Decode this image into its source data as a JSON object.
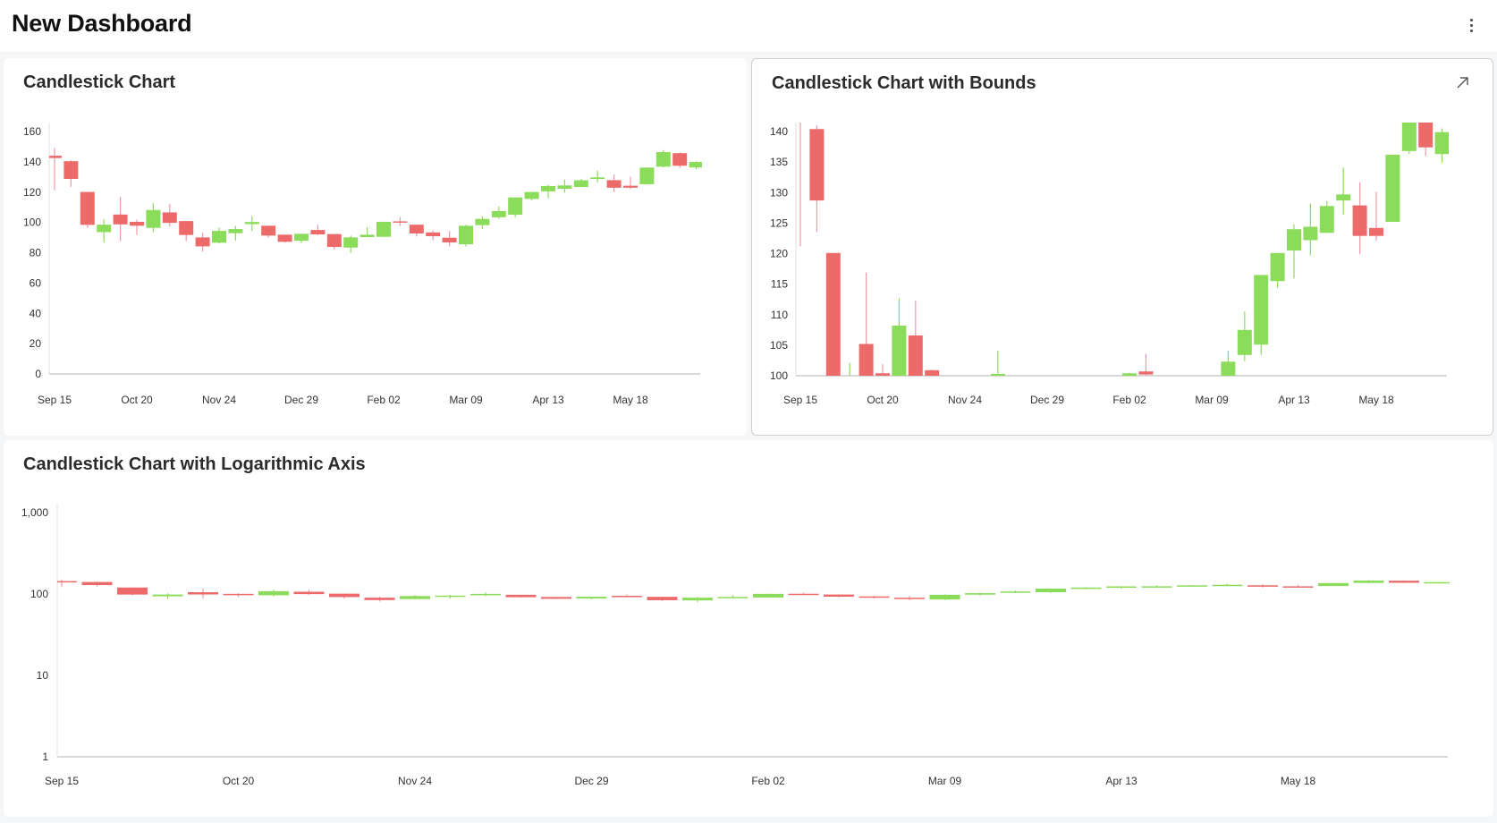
{
  "header": {
    "title": "New Dashboard",
    "more_icon": "more-vertical-icon"
  },
  "colors": {
    "up": "#8cdc5c",
    "down": "#ec6a6a",
    "down_wick": "#f29aa8",
    "axis": "#d9d9d9",
    "background": "#f5f6f8"
  },
  "cards": [
    {
      "title": "Candlestick Chart"
    },
    {
      "title": "Candlestick Chart with Bounds",
      "expand_icon": "expand-arrow-icon"
    },
    {
      "title": "Candlestick Chart with Logarithmic Axis"
    }
  ],
  "chart_data": [
    {
      "type": "candlestick",
      "title": "Candlestick Chart",
      "y_scale": "linear",
      "ylim": [
        0,
        160
      ],
      "yticks": [
        0,
        20,
        40,
        60,
        80,
        100,
        120,
        140,
        160
      ],
      "ytick_labels": [
        "0",
        "20",
        "40",
        "60",
        "80",
        "100",
        "120",
        "140",
        "160"
      ],
      "xtick_labels": [
        "Sep 15",
        "Oct 20",
        "Nov 24",
        "Dec 29",
        "Feb 02",
        "Mar 09",
        "Apr 13",
        "May 18"
      ],
      "xtick_index": [
        0,
        5,
        10,
        15,
        20,
        25,
        30,
        35
      ],
      "series_ref": "ohlc"
    },
    {
      "type": "candlestick",
      "title": "Candlestick Chart with Bounds",
      "y_scale": "linear",
      "ylim": [
        100,
        140
      ],
      "yticks": [
        100,
        105,
        110,
        115,
        120,
        125,
        130,
        135,
        140
      ],
      "ytick_labels": [
        "100",
        "105",
        "110",
        "115",
        "120",
        "125",
        "130",
        "135",
        "140"
      ],
      "xtick_labels": [
        "Sep 15",
        "Oct 20",
        "Nov 24",
        "Dec 29",
        "Feb 02",
        "Mar 09",
        "Apr 13",
        "May 18"
      ],
      "xtick_index": [
        0,
        5,
        10,
        15,
        20,
        25,
        30,
        35
      ],
      "series_ref": "ohlc"
    },
    {
      "type": "candlestick",
      "title": "Candlestick Chart with Logarithmic Axis",
      "y_scale": "log",
      "ylim": [
        1,
        1000
      ],
      "yticks": [
        1,
        10,
        100,
        1000
      ],
      "ytick_labels": [
        "1",
        "10",
        "100",
        "1,000"
      ],
      "xtick_labels": [
        "Sep 15",
        "Oct 20",
        "Nov 24",
        "Dec 29",
        "Feb 02",
        "Mar 09",
        "Apr 13",
        "May 18"
      ],
      "xtick_index": [
        0,
        5,
        10,
        15,
        20,
        25,
        30,
        35
      ],
      "series_ref": "ohlc"
    }
  ],
  "ohlc": [
    {
      "o": 144.0,
      "h": 149.2,
      "l": 121.2,
      "c": 142.5
    },
    {
      "o": 140.4,
      "h": 141.0,
      "l": 123.5,
      "c": 128.7
    },
    {
      "o": 120.1,
      "h": 120.1,
      "l": 96.2,
      "c": 98.4
    },
    {
      "o": 93.6,
      "h": 102.1,
      "l": 86.8,
      "c": 98.5
    },
    {
      "o": 105.2,
      "h": 116.9,
      "l": 87.6,
      "c": 98.7
    },
    {
      "o": 100.4,
      "h": 101.9,
      "l": 91.7,
      "c": 97.8
    },
    {
      "o": 96.4,
      "h": 112.7,
      "l": 93.6,
      "c": 108.2
    },
    {
      "o": 106.6,
      "h": 112.3,
      "l": 97.2,
      "c": 99.7
    },
    {
      "o": 100.9,
      "h": 101.0,
      "l": 87.7,
      "c": 91.7
    },
    {
      "o": 90.1,
      "h": 93.1,
      "l": 80.7,
      "c": 84.2
    },
    {
      "o": 86.6,
      "h": 96.6,
      "l": 86.2,
      "c": 94.4
    },
    {
      "o": 92.9,
      "h": 97.6,
      "l": 88.1,
      "c": 95.6
    },
    {
      "o": 98.9,
      "h": 104.1,
      "l": 94.2,
      "c": 100.3
    },
    {
      "o": 97.8,
      "h": 97.8,
      "l": 89.9,
      "c": 91.3
    },
    {
      "o": 91.9,
      "h": 91.9,
      "l": 86.6,
      "c": 87.2
    },
    {
      "o": 87.9,
      "h": 92.5,
      "l": 86.4,
      "c": 92.5
    },
    {
      "o": 95.0,
      "h": 98.5,
      "l": 91.7,
      "c": 92.1
    },
    {
      "o": 92.3,
      "h": 92.3,
      "l": 81.9,
      "c": 83.8
    },
    {
      "o": 83.4,
      "h": 91.3,
      "l": 79.9,
      "c": 90.1
    },
    {
      "o": 90.3,
      "h": 96.8,
      "l": 90.3,
      "c": 91.9
    },
    {
      "o": 90.5,
      "h": 100.5,
      "l": 90.5,
      "c": 100.4
    },
    {
      "o": 100.7,
      "h": 103.6,
      "l": 97.6,
      "c": 100.2
    },
    {
      "o": 98.5,
      "h": 98.5,
      "l": 90.7,
      "c": 92.7
    },
    {
      "o": 93.4,
      "h": 94.8,
      "l": 88.1,
      "c": 90.9
    },
    {
      "o": 89.9,
      "h": 94.4,
      "l": 84.2,
      "c": 86.8
    },
    {
      "o": 85.6,
      "h": 98.5,
      "l": 84.2,
      "c": 97.8
    },
    {
      "o": 98.2,
      "h": 104.1,
      "l": 95.8,
      "c": 102.3
    },
    {
      "o": 103.4,
      "h": 110.5,
      "l": 102.4,
      "c": 107.5
    },
    {
      "o": 105.1,
      "h": 116.5,
      "l": 103.4,
      "c": 116.5
    },
    {
      "o": 115.5,
      "h": 120.1,
      "l": 114.4,
      "c": 120.1
    },
    {
      "o": 120.5,
      "h": 124.8,
      "l": 115.9,
      "c": 124.0
    },
    {
      "o": 122.2,
      "h": 128.2,
      "l": 119.7,
      "c": 124.4
    },
    {
      "o": 123.4,
      "h": 128.6,
      "l": 123.4,
      "c": 127.8
    },
    {
      "o": 128.7,
      "h": 134.1,
      "l": 126.4,
      "c": 129.7
    },
    {
      "o": 127.9,
      "h": 131.7,
      "l": 119.9,
      "c": 122.9
    },
    {
      "o": 124.2,
      "h": 130.1,
      "l": 122.1,
      "c": 122.9
    },
    {
      "o": 125.2,
      "h": 136.2,
      "l": 125.2,
      "c": 136.2
    },
    {
      "o": 136.8,
      "h": 147.8,
      "l": 136.3,
      "c": 146.4
    },
    {
      "o": 145.7,
      "h": 146.3,
      "l": 136.0,
      "c": 137.4
    },
    {
      "o": 136.3,
      "h": 140.5,
      "l": 134.9,
      "c": 139.9
    }
  ]
}
